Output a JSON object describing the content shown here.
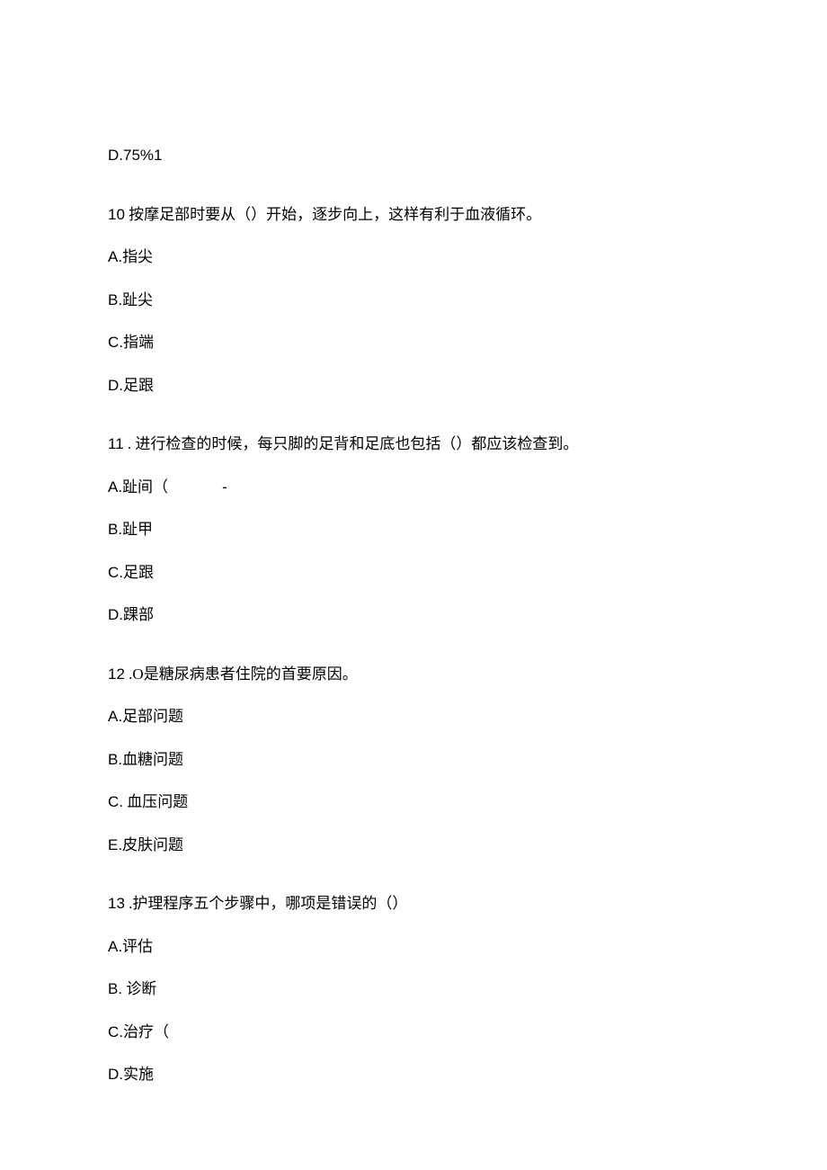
{
  "q9": {
    "optD": "D.75%1"
  },
  "q10": {
    "stem_num": "10",
    "stem_text": " 按摩足部时要从（）开始，逐步向上，这样有利于血液循环。",
    "optA_label": "A.",
    "optA_text": "指尖",
    "optB_label": "B.",
    "optB_text": "趾尖",
    "optC_label": "C.",
    "optC_text": "指端",
    "optD_label": "D.",
    "optD_text": "足跟"
  },
  "q11": {
    "stem_num": "11",
    "stem_text": " . 进行检查的时候，每只脚的足背和足底也包括（）都应该检查到。",
    "optA_label": "A.",
    "optA_text": "趾间（",
    "optA_extra": "-",
    "optB_label": "B.",
    "optB_text": "趾甲",
    "optC_label": "C.",
    "optC_text": "足跟",
    "optD_label": "D.",
    "optD_text": "踝部"
  },
  "q12": {
    "stem_num": "12",
    "stem_text": " .O是糖尿病患者住院的首要原因。",
    "optA_label": "A.",
    "optA_text": "足部问题",
    "optB_label": "B.",
    "optB_text": "血糖问题",
    "optC_label": "C.",
    "optC_text": " 血压问题",
    "optE_label": "E.",
    "optE_text": "皮肤问题"
  },
  "q13": {
    "stem_num": "13",
    "stem_text": " .护理程序五个步骤中，哪项是错误的（）",
    "optA_label": "A.",
    "optA_text": "评估",
    "optB_label": "B.",
    "optB_text": " 诊断",
    "optC_label": "C.",
    "optC_text": "治疗（",
    "optD_label": "D.",
    "optD_text": "实施"
  }
}
